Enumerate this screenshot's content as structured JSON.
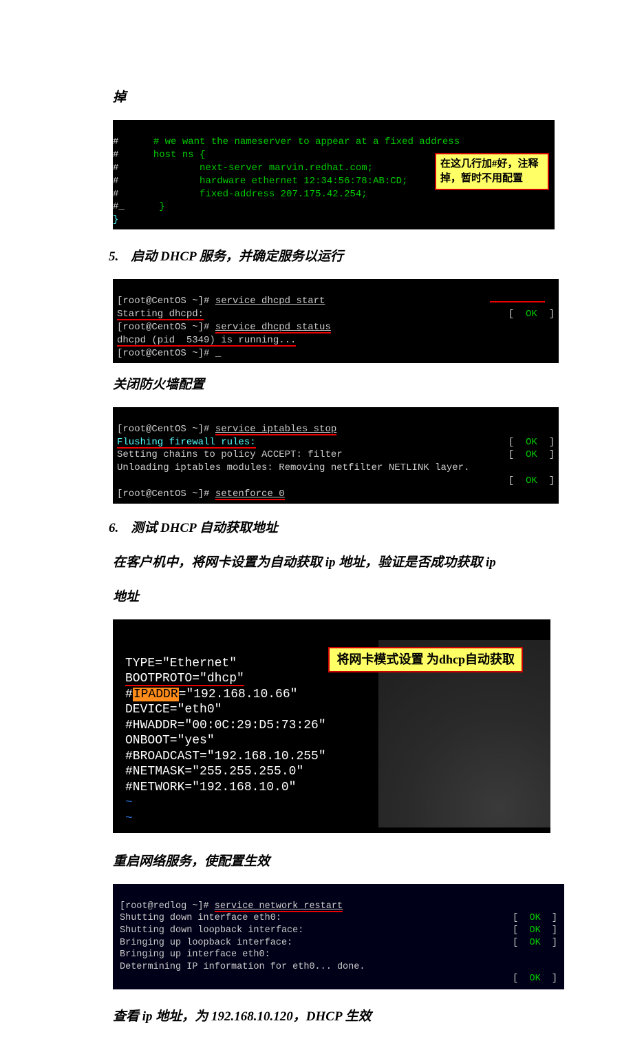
{
  "p0": "掉",
  "block1": {
    "l1_hash": "#",
    "l1_comment": "# we want the nameserver to appear at a fixed address",
    "l2_hash": "#",
    "l2": "host ns {",
    "l3_hash": "#",
    "l3": "        next-server marvin.redhat.com;",
    "l4_hash": "#",
    "l4": "        hardware ethernet 12:34:56:78:AB:CD;",
    "l5_hash": "#",
    "l5": "        fixed-address 207.175.42.254;",
    "l6_hash": "#_",
    "l6": "}",
    "l7_hash": "}",
    "callout": "在这几行加#好，注释掉，暂时不用配置"
  },
  "s5": {
    "num": "5.",
    "txt": "启动 DHCP 服务，并确定服务以运行"
  },
  "block2": {
    "l1a": "[root@CentOS ~]# ",
    "l1b": "service dhcpd start",
    "l2": "Starting dhcpd:",
    "ok1l": "[  ",
    "ok1": "OK",
    "ok1r": "  ]",
    "l3a": "[root@CentOS ~]# ",
    "l3b": "service dhcpd status",
    "l4": "dhcpd (pid  5349) is running...",
    "l5": "[root@CentOS ~]# _"
  },
  "p_fw": "关闭防火墙配置",
  "block3": {
    "l1a": "[root@CentOS ~]# ",
    "l1b": "service iptables stop",
    "l2": "Flushing firewall rules:",
    "l3": "Setting chains to policy ACCEPT: filter",
    "l4": "Unloading iptables modules: Removing netfilter NETLINK layer.",
    "l5a": "[root@CentOS ~]# ",
    "l5b": "setenforce 0",
    "okl": "[  ",
    "ok": "OK",
    "okr": "  ]"
  },
  "s6": {
    "num": "6.",
    "txt": "测试 DHCP 自动获取地址"
  },
  "p_client": "在客户机中，将网卡设置为自动获取 ip 地址，验证是否成功获取 ip",
  "p_addr": "地址",
  "block4": {
    "l1": "TYPE=\"Ethernet\"",
    "l2": "BOOTPROTO=\"dhcp\"",
    "l3a": "#",
    "l3b": "IPADDR",
    "l3c": "=\"192.168.10.66\"",
    "l4": "DEVICE=\"eth0\"",
    "l5": "#HWADDR=\"00:0C:29:D5:73:26\"",
    "l6": "ONBOOT=\"yes\"",
    "l7": "#BROADCAST=\"192.168.10.255\"",
    "l8": "#NETMASK=\"255.255.255.0\"",
    "l9": "#NETWORK=\"192.168.10.0\"",
    "t1": "~",
    "t2": "~",
    "callout": "将网卡模式设置\n为dhcp自动获取"
  },
  "p_restart": "重启网络服务，使配置生效",
  "block5": {
    "l1a": "[root@redlog ~]# ",
    "l1b": "service network restart",
    "l2": "Shutting down interface eth0:",
    "l3": "Shutting down loopback interface:",
    "l4": "Bringing up loopback interface:",
    "l5": "Bringing up interface eth0:",
    "l6": "Determining IP information for eth0... done.",
    "okl": "[  ",
    "ok": "OK",
    "okr": "  ]"
  },
  "p_result": "查看 ip 地址，为 192.168.10.120，DHCP 生效"
}
